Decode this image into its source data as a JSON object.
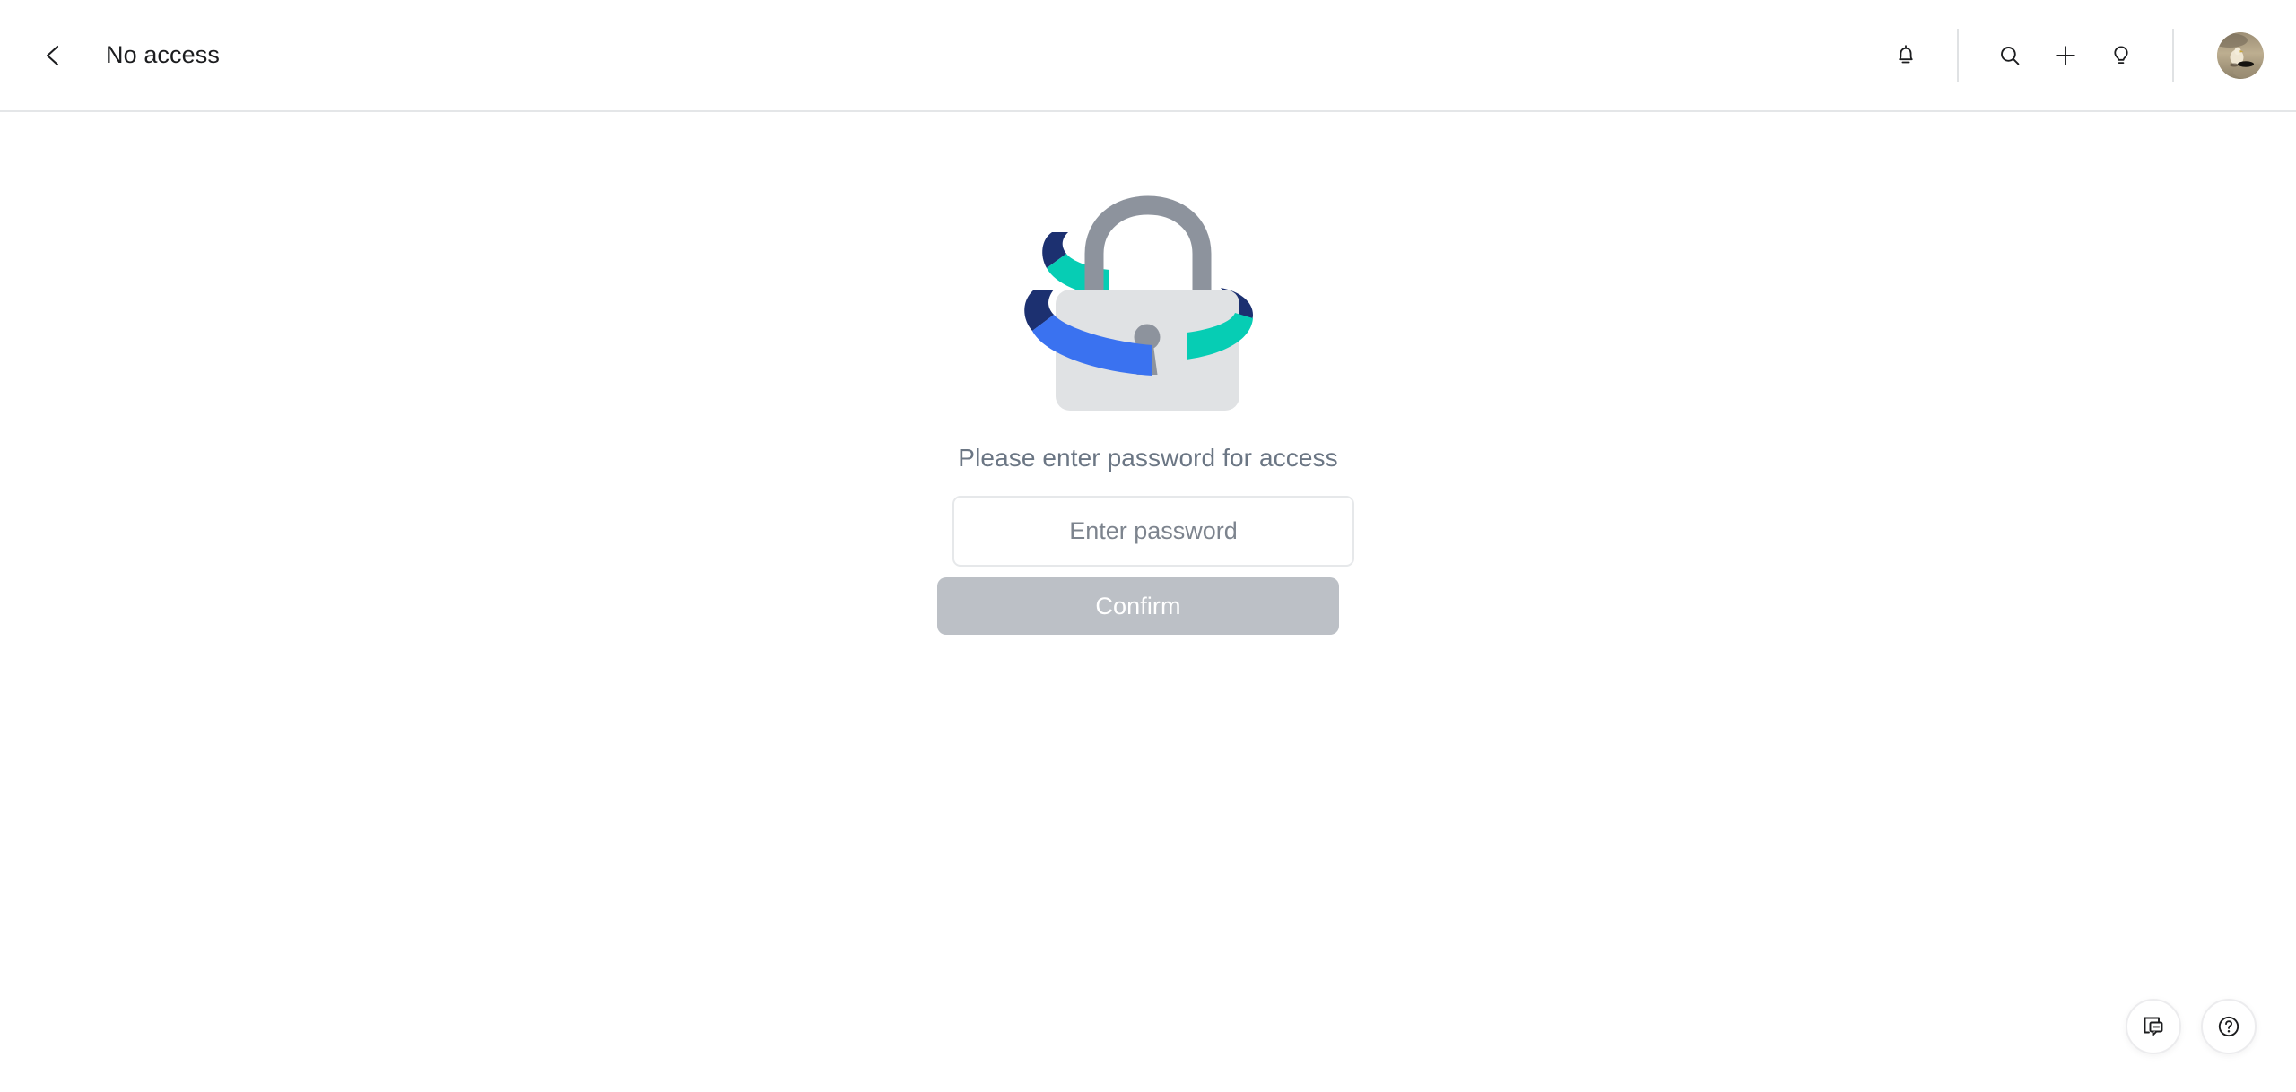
{
  "header": {
    "back_icon": "chevron-left-icon",
    "title": "No access",
    "actions": [
      {
        "name": "notifications-button",
        "icon": "bell-icon"
      },
      {
        "name": "search-button",
        "icon": "search-icon"
      },
      {
        "name": "create-button",
        "icon": "plus-icon"
      },
      {
        "name": "tips-button",
        "icon": "lightbulb-icon"
      }
    ],
    "avatar": {
      "name": "user-avatar",
      "alt": "User profile photo"
    }
  },
  "main": {
    "illustration": {
      "name": "locked-padlock-illustration",
      "colors": {
        "lock_body": "#e0e2e4",
        "lock_shackle": "#8d939d",
        "keyhole": "#8d939d",
        "ribbon_navy": "#1c3070",
        "ribbon_teal": "#06cdb4",
        "ribbon_blue": "#3a72f0"
      }
    },
    "prompt": "Please enter password for access",
    "password_field": {
      "placeholder": "Enter password",
      "value": "",
      "type": "password"
    },
    "confirm_label": "Confirm",
    "confirm_disabled": true
  },
  "floating": {
    "feedback": {
      "name": "feedback-button",
      "icon": "comment-box-icon"
    },
    "help": {
      "name": "help-button",
      "icon": "question-circle-icon"
    }
  },
  "colors": {
    "page_background": "#ffffff",
    "header_border": "#e4e6e8",
    "title_text": "#1c1d1f",
    "prompt_text": "#6b7684",
    "button_disabled_bg": "#bcc0c6",
    "input_border": "#e6e8ea"
  }
}
